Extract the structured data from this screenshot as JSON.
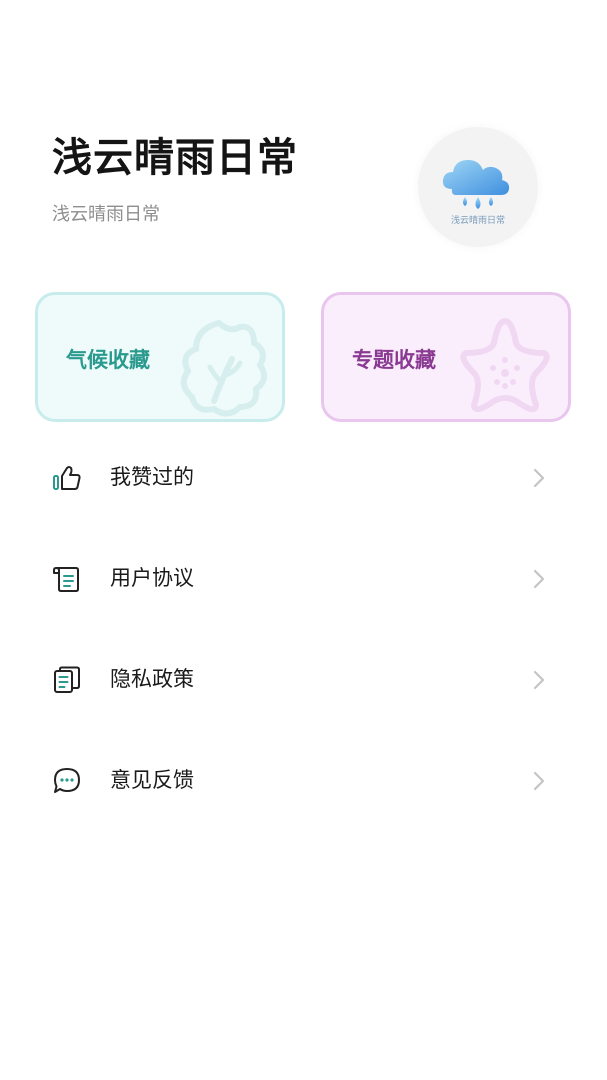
{
  "header": {
    "title": "浅云晴雨日常",
    "subtitle": "浅云晴雨日常",
    "avatar_caption": "浅云晴雨日常"
  },
  "cards": [
    {
      "label": "气候收藏",
      "accent": "#2a9a8e",
      "icon": "leaf-icon"
    },
    {
      "label": "专题收藏",
      "accent": "#8a3a92",
      "icon": "star-icon"
    }
  ],
  "menu": {
    "items": [
      {
        "label": "我赞过的",
        "icon": "thumbs-up-icon"
      },
      {
        "label": "用户协议",
        "icon": "scroll-document-icon"
      },
      {
        "label": "隐私政策",
        "icon": "documents-icon"
      },
      {
        "label": "意见反馈",
        "icon": "chat-bubble-icon"
      }
    ]
  },
  "colors": {
    "background": "#ffffff",
    "title": "#141414",
    "subtitle": "#8e8e8e",
    "chevron": "#c4c4c4"
  }
}
